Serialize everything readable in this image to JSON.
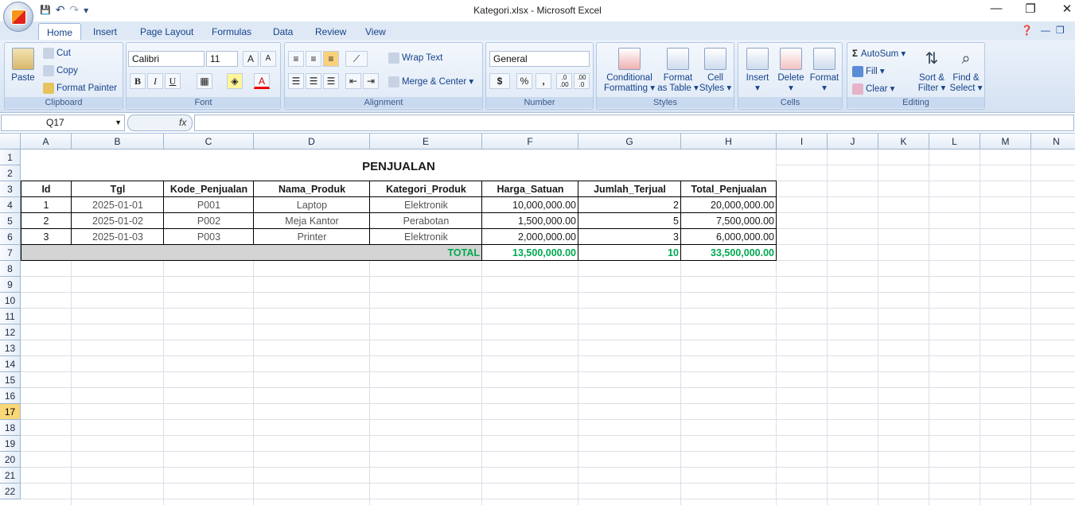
{
  "window": {
    "title": "Kategori.xlsx - Microsoft Excel",
    "minimize": "—",
    "restore": "❐",
    "close": "✕"
  },
  "qat": {
    "save": "💾",
    "undo": "↶",
    "redo": "↷",
    "more": "▾"
  },
  "tabs": [
    "Home",
    "Insert",
    "Page Layout",
    "Formulas",
    "Data",
    "Review",
    "View"
  ],
  "ribbon": {
    "clipboard": {
      "label": "Clipboard",
      "paste": "Paste",
      "cut": "Cut",
      "copy": "Copy",
      "format_painter": "Format Painter"
    },
    "font": {
      "label": "Font",
      "family": "Calibri",
      "size": "11",
      "grow": "A",
      "shrink": "A",
      "bold": "B",
      "italic": "I",
      "underline": "U",
      "font_color": "A"
    },
    "alignment": {
      "label": "Alignment",
      "wrap": "Wrap Text",
      "merge": "Merge & Center"
    },
    "number": {
      "label": "Number",
      "format": "General",
      "currency": "$",
      "percent": "%",
      "comma": ",",
      "inc": ".0 .00",
      "dec": ".00 .0"
    },
    "styles": {
      "label": "Styles",
      "conditional": "Conditional",
      "conditional2": "Formatting",
      "format_table": "Format",
      "format_table2": "as Table",
      "cell_styles": "Cell",
      "cell_styles2": "Styles"
    },
    "cells": {
      "label": "Cells",
      "insert": "Insert",
      "delete": "Delete",
      "format": "Format"
    },
    "editing": {
      "label": "Editing",
      "autosum": "AutoSum",
      "fill": "Fill",
      "clear": "Clear",
      "sort": "Sort &",
      "sort2": "Filter",
      "find": "Find &",
      "find2": "Select"
    }
  },
  "formula_bar": {
    "name_box": "Q17",
    "fx": "fx",
    "value": ""
  },
  "columns": [
    "A",
    "B",
    "C",
    "D",
    "E",
    "F",
    "G",
    "H",
    "I",
    "J",
    "K",
    "L",
    "M",
    "N"
  ],
  "rows": [
    "1",
    "2",
    "3",
    "4",
    "5",
    "6",
    "7",
    "8",
    "9",
    "10",
    "11",
    "12",
    "13",
    "14",
    "15",
    "16",
    "17",
    "18",
    "19",
    "20",
    "21",
    "22"
  ],
  "selected_row": "17",
  "sheet": {
    "title": "PENJUALAN",
    "headers": [
      "Id",
      "Tgl",
      "Kode_Penjualan",
      "Nama_Produk",
      "Kategori_Produk",
      "Harga_Satuan",
      "Jumlah_Terjual",
      "Total_Penjualan"
    ],
    "data": [
      [
        "1",
        "2025-01-01",
        "P001",
        "Laptop",
        "Elektronik",
        "10,000,000.00",
        "2",
        "20,000,000.00"
      ],
      [
        "2",
        "2025-01-02",
        "P002",
        "Meja Kantor",
        "Perabotan",
        "1,500,000.00",
        "5",
        "7,500,000.00"
      ],
      [
        "3",
        "2025-01-03",
        "P003",
        "Printer",
        "Elektronik",
        "2,000,000.00",
        "3",
        "6,000,000.00"
      ]
    ],
    "total": {
      "label": "TOTAL",
      "harga": "13,500,000.00",
      "jumlah": "10",
      "penjualan": "33,500,000.00"
    }
  }
}
